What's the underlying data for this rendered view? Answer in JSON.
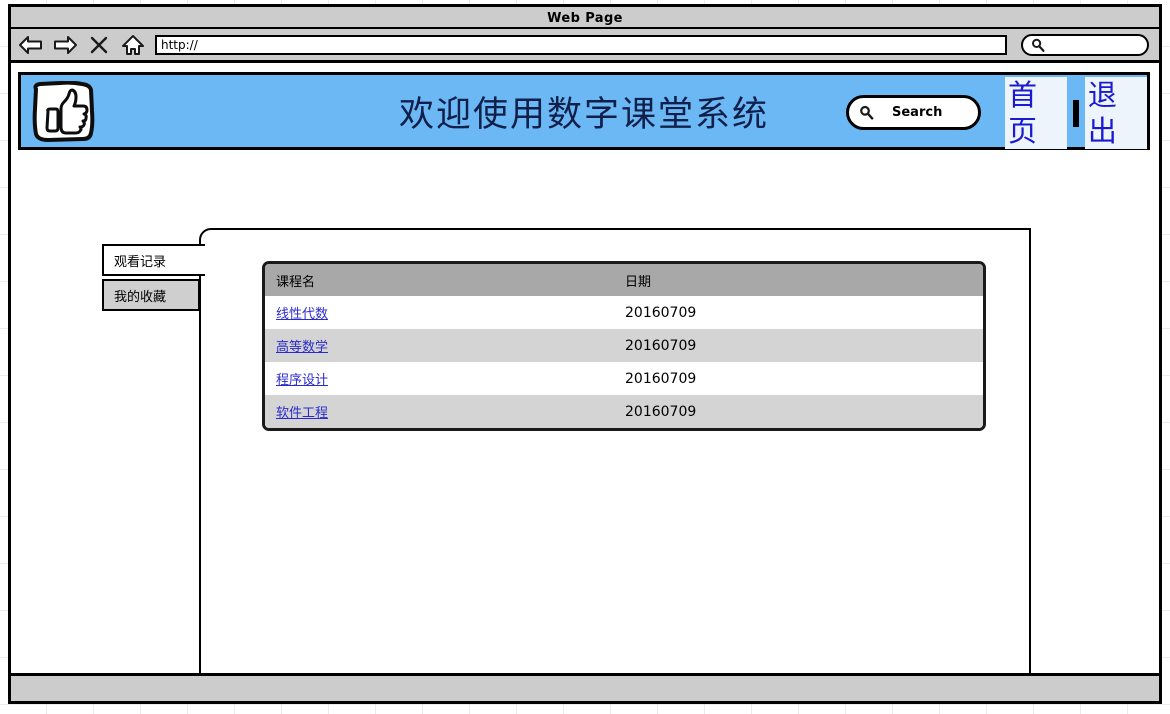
{
  "browser": {
    "title": "Web Page",
    "back_icon": "back-arrow-icon",
    "forward_icon": "forward-arrow-icon",
    "stop_icon": "close-x-icon",
    "home_icon": "home-icon",
    "url_value": "http://",
    "url_placeholder": "http://",
    "search_value": "",
    "search_placeholder": "",
    "search_icon": "search-icon"
  },
  "header": {
    "logo_icon": "thumbs-up-icon",
    "title": "欢迎使用数字课堂系统",
    "search": {
      "icon": "search-icon",
      "placeholder": "Search",
      "value": ""
    },
    "nav": [
      {
        "label": "首页",
        "name": "nav-link-home"
      },
      {
        "label": "退出",
        "name": "nav-link-logout"
      }
    ],
    "separator": "|",
    "bg_color": "#6cb8f5",
    "title_color": "#11204a",
    "link_color": "#1a1ad0"
  },
  "tabs": [
    {
      "label": "观看记录",
      "active": true
    },
    {
      "label": "我的收藏",
      "active": false
    }
  ],
  "table": {
    "columns": [
      "课程名",
      "日期"
    ],
    "rows": [
      {
        "course": "线性代数",
        "date": "20160709"
      },
      {
        "course": "高等数学",
        "date": "20160709"
      },
      {
        "course": "程序设计",
        "date": "20160709"
      },
      {
        "course": "软件工程",
        "date": "20160709"
      }
    ],
    "header_bg": "#a8a8a8",
    "row_odd_bg": "#ffffff",
    "row_even_bg": "#d4d4d4",
    "link_color": "#2b2bcc"
  }
}
